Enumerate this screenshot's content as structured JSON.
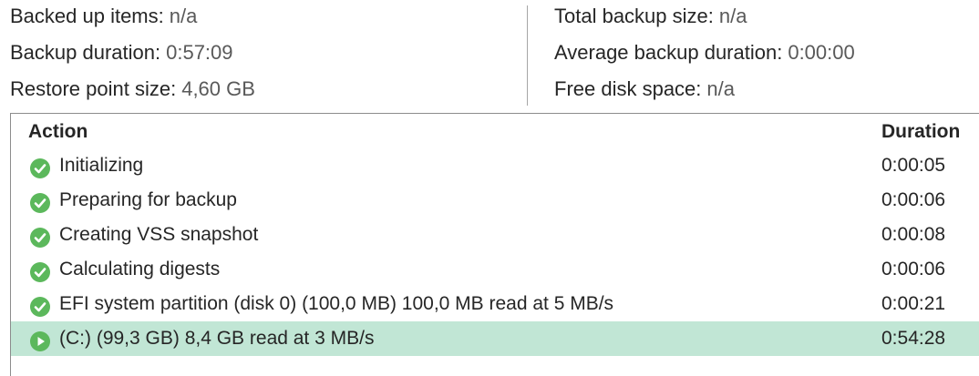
{
  "summary": {
    "left": [
      {
        "label": "Backed up items:",
        "value": "n/a"
      },
      {
        "label": "Backup duration:",
        "value": "0:57:09"
      },
      {
        "label": "Restore point size:",
        "value": "4,60 GB"
      }
    ],
    "right": [
      {
        "label": "Total backup size:",
        "value": "n/a"
      },
      {
        "label": "Average backup duration:",
        "value": "0:00:00"
      },
      {
        "label": "Free disk space:",
        "value": "n/a"
      }
    ]
  },
  "table": {
    "headers": {
      "action": "Action",
      "duration": "Duration"
    },
    "rows": [
      {
        "status": "success",
        "icon": "check-circle-icon",
        "action": "Initializing",
        "duration": "0:00:05"
      },
      {
        "status": "success",
        "icon": "check-circle-icon",
        "action": "Preparing for backup",
        "duration": "0:00:06"
      },
      {
        "status": "success",
        "icon": "check-circle-icon",
        "action": "Creating VSS snapshot",
        "duration": "0:00:08"
      },
      {
        "status": "success",
        "icon": "check-circle-icon",
        "action": "Calculating digests",
        "duration": "0:00:06"
      },
      {
        "status": "success",
        "icon": "check-circle-icon",
        "action": "EFI system partition (disk 0) (100,0 MB) 100,0 MB read at 5 MB/s",
        "duration": "0:00:21"
      },
      {
        "status": "running",
        "icon": "play-circle-icon",
        "action": "(C:) (99,3 GB) 8,4 GB read at 3 MB/s",
        "duration": "0:54:28"
      }
    ]
  },
  "colors": {
    "status_green": "#5cb85c",
    "running_row_highlight": "#c1e6d5"
  }
}
